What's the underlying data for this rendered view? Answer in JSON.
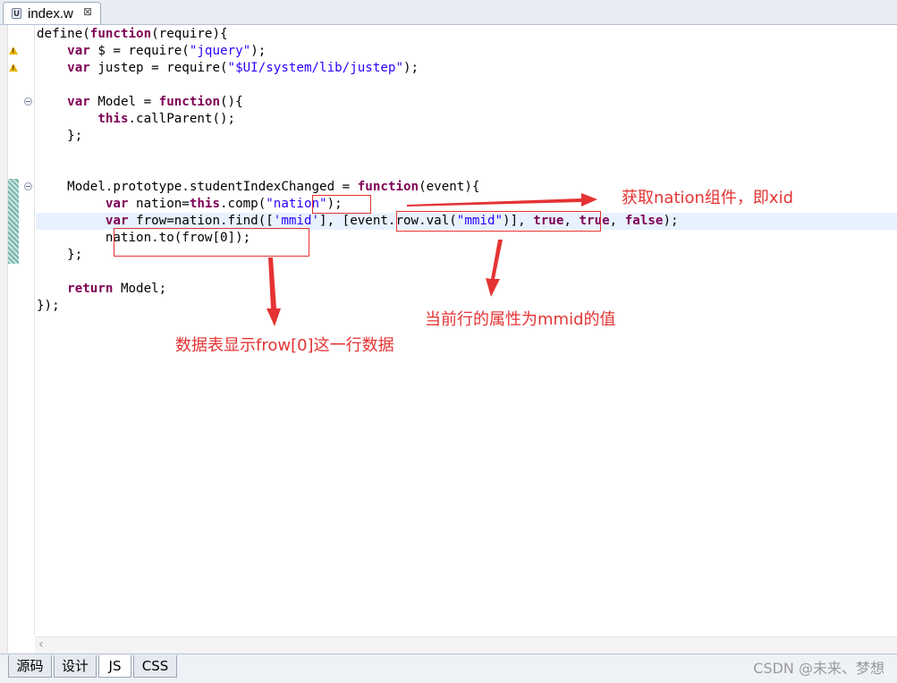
{
  "editor_tab": {
    "icon": "js-file-icon",
    "label": "index.w",
    "close_glyph": "⊠"
  },
  "code": {
    "lines": [
      "define(function(require){",
      "    var $ = require(\"jquery\");",
      "    var justep = require(\"$UI/system/lib/justep\");",
      "",
      "    var Model = function(){",
      "        this.callParent();",
      "    };",
      "",
      "",
      "    Model.prototype.studentIndexChanged = function(event){",
      "         var nation=this.comp(\"nation\");",
      "         var frow=nation.find(['mmid'], [event.row.val(\"mmid\")], true, true, false);",
      "         nation.to(frow[0]);",
      "    };",
      "",
      "    return Model;",
      "});"
    ]
  },
  "annotations": {
    "nation_note": "获取nation组件，即xid",
    "mmid_note": "当前行的属性为mmid的值",
    "frow_note": "数据表显示frow[0]这一行数据"
  },
  "scroll_arrow": "‹",
  "bottom_tabs": [
    "源码",
    "设计",
    "JS",
    "CSS"
  ],
  "active_bottom_tab": "JS",
  "watermark": "CSDN @未来、梦想",
  "colors": {
    "keyword": "#7f0055",
    "string": "#2a00ff",
    "annotation": "#e53333",
    "current_line": "#e8f2fe"
  }
}
